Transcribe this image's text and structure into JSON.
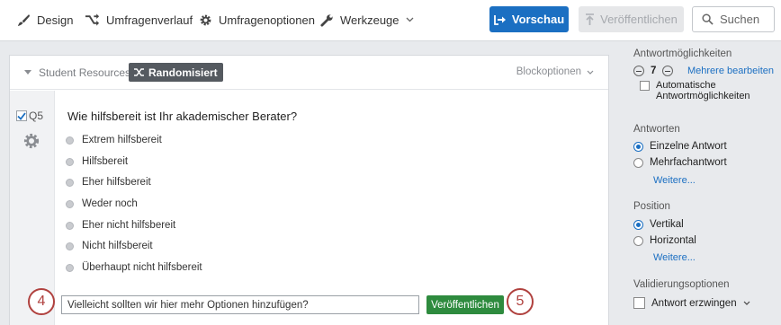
{
  "toolbar": {
    "design": "Design",
    "flow": "Umfragenverlauf",
    "options": "Umfragenoptionen",
    "tools": "Werkzeuge",
    "preview": "Vorschau",
    "publish": "Veröffentlichen",
    "search_placeholder": "Suchen"
  },
  "block": {
    "name": "Student Resources",
    "random_badge": "Randomisiert",
    "options": "Blockoptionen"
  },
  "question": {
    "id": "Q5",
    "text": "Wie hilfsbereit ist Ihr akademischer Berater?",
    "choices": [
      "Extrem hilfsbereit",
      "Hilfsbereit",
      "Eher hilfsbereit",
      "Weder noch",
      "Eher nicht hilfsbereit",
      "Nicht hilfsbereit",
      "Überhaupt nicht hilfsbereit"
    ]
  },
  "comment": {
    "value": "Vielleicht sollten wir hier mehr Optionen hinzufügen?",
    "publish": "Veröffentlichen",
    "step_left": "4",
    "step_right": "5"
  },
  "sidebar": {
    "answer_options_heading": "Antwortmöglichkeiten",
    "count": "7",
    "edit_multiple": "Mehrere bearbeiten",
    "auto_options_line1": "Automatische",
    "auto_options_line2": "Antwortmöglichkeiten",
    "answers_heading": "Antworten",
    "single": "Einzelne Antwort",
    "multiple": "Mehrfachantwort",
    "more1": "Weitere...",
    "position_heading": "Position",
    "vertical": "Vertikal",
    "horizontal": "Horizontal",
    "more2": "Weitere...",
    "validation_heading": "Validierungsoptionen",
    "force": "Antwort erzwingen"
  },
  "colors": {
    "accent": "#1b6fc2",
    "publish_green": "#2e8b3e",
    "step_circle": "#b0413e"
  }
}
